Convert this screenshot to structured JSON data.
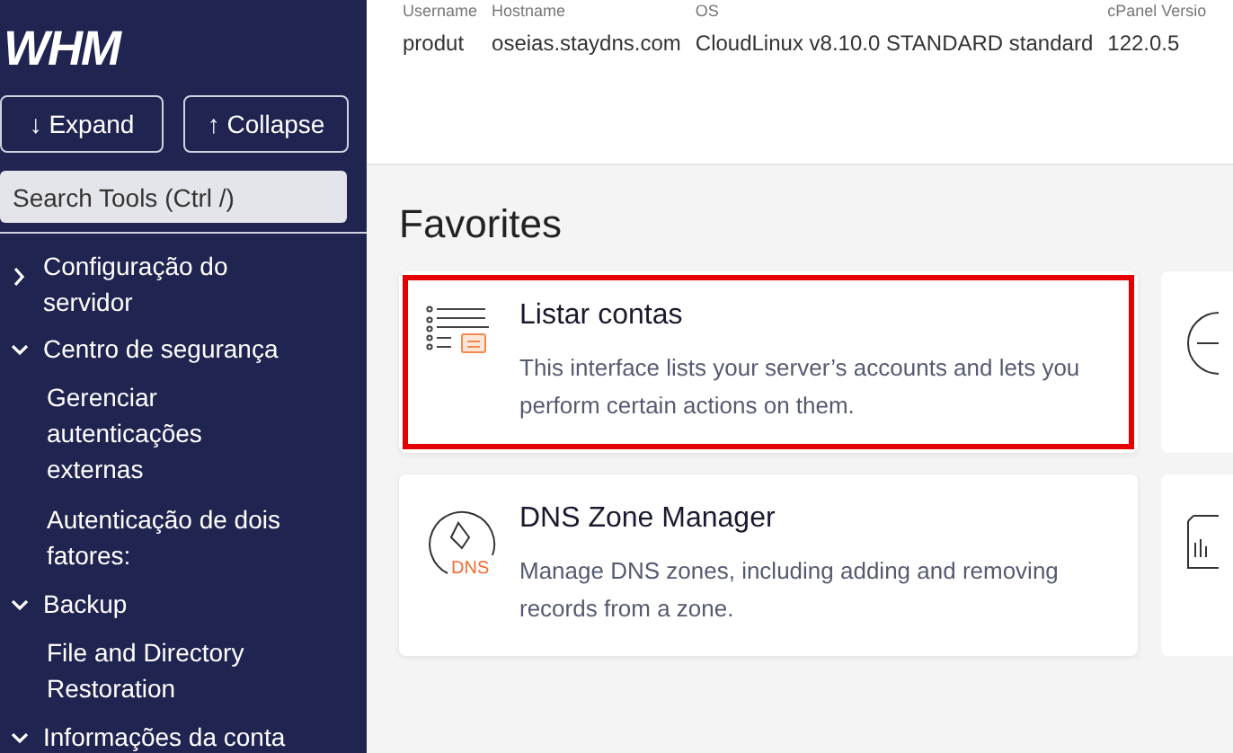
{
  "sidebar": {
    "logo": "WHM",
    "buttons": [
      {
        "kind": "expand",
        "label": "Expand",
        "arrow": "↓"
      },
      {
        "kind": "collapse",
        "label": "Collapse",
        "arrow": "↑"
      }
    ],
    "search": {
      "placeholder": "Search Tools (Ctrl /)"
    },
    "items": [
      {
        "label": "Configuração do servidor",
        "expanded": false
      },
      {
        "label": "Centro de segurança",
        "expanded": true,
        "children": [
          {
            "label": "Gerenciar autenticações externas"
          },
          {
            "label": "Autenticação de dois fatores:"
          }
        ]
      },
      {
        "label": "Backup",
        "expanded": true,
        "children": [
          {
            "label": "File and Directory Restoration"
          }
        ]
      },
      {
        "label": "Informações da conta",
        "expanded": true
      }
    ]
  },
  "server_info": [
    {
      "label": "Username",
      "value": "produt"
    },
    {
      "label": "Hostname",
      "value": "oseias.staydns.com"
    },
    {
      "label": "OS",
      "value": "CloudLinux v8.10.0 STANDARD standard"
    },
    {
      "label": "cPanel Versio",
      "value": "122.0.5"
    }
  ],
  "heading": "Favorites",
  "cards": [
    {
      "kind": "list",
      "title": "Listar contas",
      "description": "This interface lists your server’s accounts and lets you perform certain actions on them.",
      "highlighted": true
    },
    {
      "kind": "dns",
      "title": "DNS Zone Manager",
      "description": "Manage DNS zones, including adding and removing records from a zone.",
      "icon_text": "DNS",
      "highlighted": false
    }
  ]
}
